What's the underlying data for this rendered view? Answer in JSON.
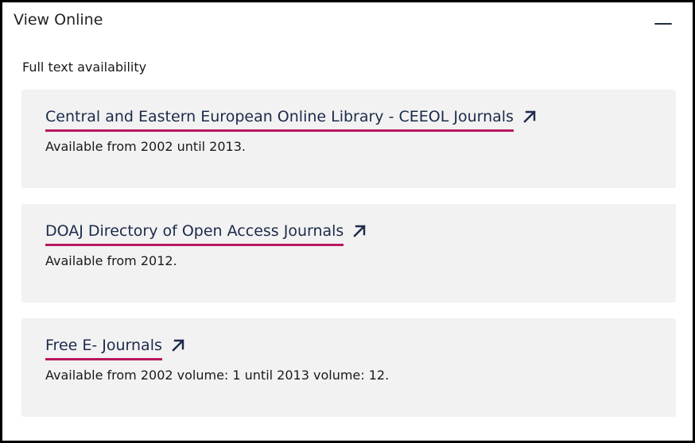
{
  "panel": {
    "title": "View Online",
    "collapse_icon": "minus-icon"
  },
  "section": {
    "label": "Full text availability"
  },
  "sources": [
    {
      "name": "Central and Eastern European Online Library - CEEOL Journals",
      "availability": "Available from 2002 until 2013.",
      "icon": "external-link-icon"
    },
    {
      "name": "DOAJ Directory of Open Access Journals",
      "availability": "Available from 2012.",
      "icon": "external-link-icon"
    },
    {
      "name": "Free E- Journals",
      "availability": "Available from 2002 volume: 1 until 2013 volume: 12.",
      "icon": "external-link-icon"
    }
  ],
  "colors": {
    "link_text": "#1c2a4a",
    "link_underline": "#b8175f",
    "card_background": "#f2f2f2",
    "border": "#000000"
  }
}
